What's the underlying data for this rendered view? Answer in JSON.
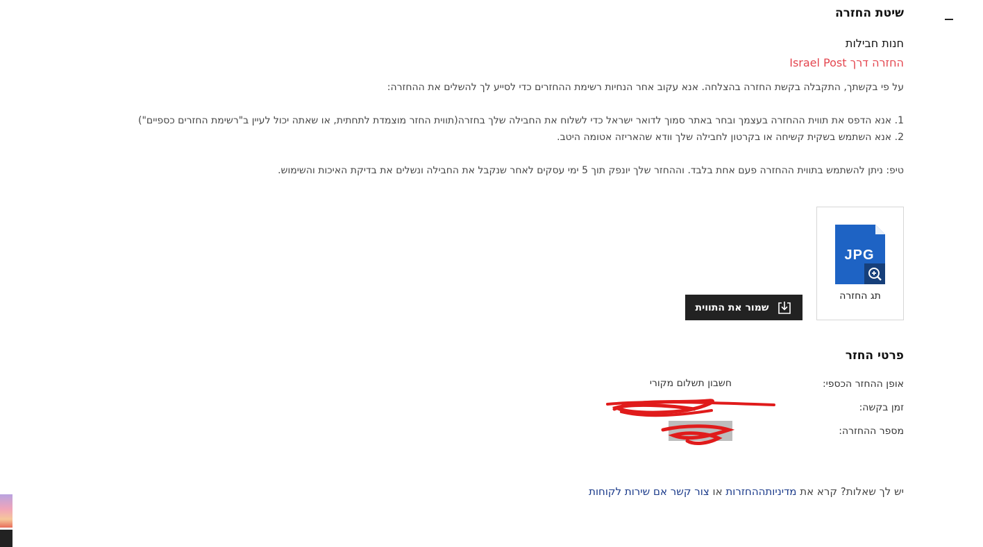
{
  "section": {
    "title": "שיטת החזרה"
  },
  "store_name": "חנות חבילות",
  "method": "החזרה דרך Israel Post",
  "instructions": {
    "intro": "על פי בקשתך, התקבלה בקשת החזרה בהצלחה. אנא עקוב אחר הנחיות רשימת ההחזרים כדי לסייע לך להשלים את ההחזרה:",
    "steps": [
      "1. אנא הדפס את תווית ההחזרה בעצמך ובחר באתר סמוך לדואר ישראל כדי לשלוח את החבילה שלך בחזרה(תווית החזר מוצמדת לתחתית, או שאתה יכול לעיין ב\"רשימת החזרים כספיים\")",
      "2. אנא השתמש בשקית קשיחה או בקרטון לחבילה שלך וודא שהאריזה אטומה היטב."
    ],
    "tip": "טיפ: ניתן להשתמש בתווית ההחזרה פעם אחת בלבד. וההחזר שלך יונפק תוך 5 ימי עסקים לאחר שנקבל את החבילה ונשלים את בדיקת האיכות והשימוש."
  },
  "label_card": {
    "file_type": "JPG",
    "caption": "תג החזרה"
  },
  "save_button": {
    "label": "שמור את התווית"
  },
  "details": {
    "title": "פרטי החזר",
    "rows": [
      {
        "label": "אופן ההחזר הכספי:",
        "value": "חשבון תשלום מקורי"
      },
      {
        "label": "זמן בקשה:",
        "value": ""
      },
      {
        "label": "מספר ההחזרה:",
        "value": ""
      }
    ]
  },
  "help": {
    "prefix": "יש לך שאלות? קרא את",
    "policy_link": "מדיניותההחזרות",
    "middle": "או",
    "contact_link": "צור קשר אם שירות לקוחות"
  },
  "colors": {
    "accent_red": "#e4464f",
    "link_blue": "#1a3a8a",
    "file_blue": "#1e63c4",
    "button_dark": "#222222"
  }
}
